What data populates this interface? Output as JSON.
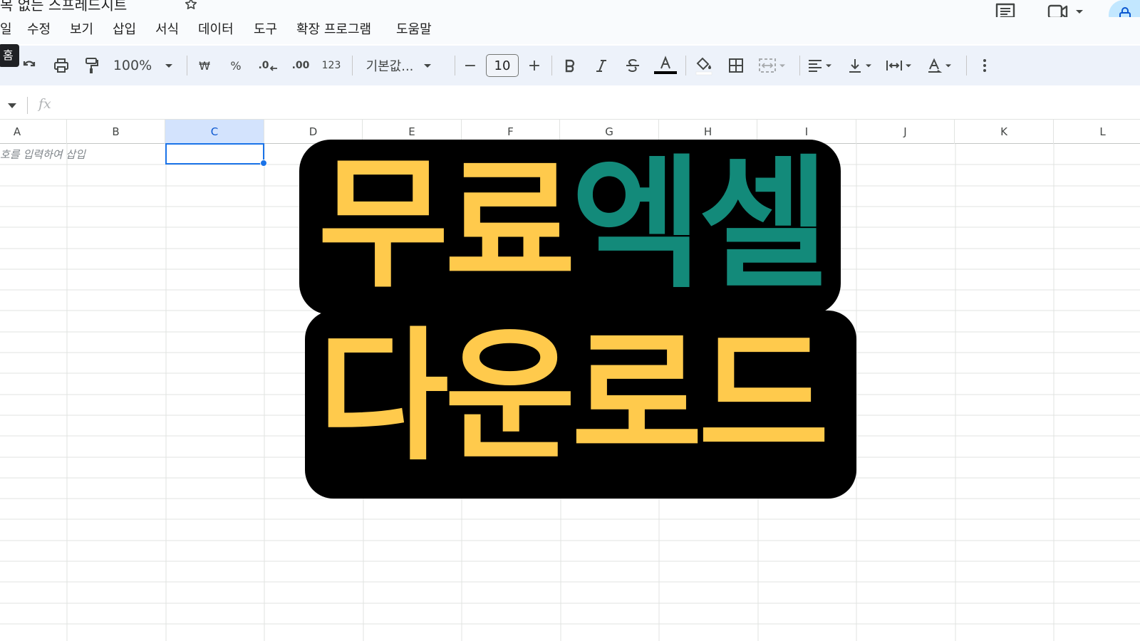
{
  "document": {
    "title": "목 없는 스프레드시트"
  },
  "menu": {
    "items": [
      "일",
      "수정",
      "보기",
      "삽입",
      "서식",
      "데이터",
      "도구",
      "확장 프로그램",
      "도움말"
    ]
  },
  "toolbar": {
    "tooltip": "홈",
    "zoom": "100%",
    "currency": "₩",
    "percent": "%",
    "decrease_decimal": ".0",
    "increase_decimal": ".00",
    "number_format": "123",
    "font": "기본값...",
    "font_size": "10",
    "decrease_font": "−",
    "increase_font": "+"
  },
  "formula_bar": {
    "fx": "fx"
  },
  "sheet": {
    "columns": [
      "A",
      "B",
      "C",
      "D",
      "E",
      "F",
      "G",
      "H",
      "I",
      "J",
      "K",
      "L"
    ],
    "selected_column": "C",
    "cell_hint": "호를 입력하여 삽입"
  },
  "banner": {
    "line1_word1": "무료",
    "line1_word2": "엑셀",
    "line2": "다운로드"
  },
  "colors": {
    "accent_blue": "#1a73e8",
    "banner_yellow": "#ffca4c",
    "banner_teal": "#138a7a",
    "banner_outline": "#000000"
  },
  "icons": {
    "title_bar": [
      "star-icon",
      "comments-icon",
      "meet-icon",
      "lock-icon"
    ],
    "toolbar": [
      "undo-icon",
      "redo-icon",
      "print-icon",
      "paint-format-icon",
      "bold-icon",
      "italic-icon",
      "strikethrough-icon",
      "text-color-icon",
      "fill-color-icon",
      "borders-icon",
      "merge-cells-icon",
      "align-icon",
      "vertical-align-icon",
      "text-wrap-icon",
      "text-rotation-icon",
      "more-icon"
    ]
  }
}
